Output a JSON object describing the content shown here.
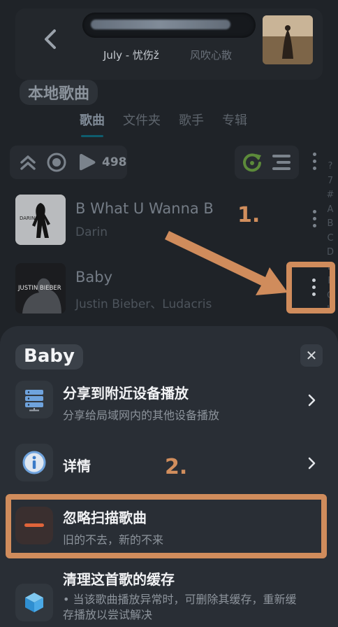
{
  "header": {
    "now_playing_title": "July - 忧伤ž",
    "now_playing_artist": "风吹心散"
  },
  "section_title": "本地歌曲",
  "tabs": [
    {
      "label": "歌曲",
      "active": true
    },
    {
      "label": "文件夹",
      "active": false
    },
    {
      "label": "歌手",
      "active": false
    },
    {
      "label": "专辑",
      "active": false
    }
  ],
  "toolbar": {
    "count": "498"
  },
  "alphabet_index": [
    "?",
    "7",
    "#",
    "A",
    "B",
    "C",
    "D",
    "E",
    "F",
    "G",
    "H"
  ],
  "songs": [
    {
      "title": "B What U Wanna B",
      "artist": "Darin",
      "cover_text": "DARIN"
    },
    {
      "title": "Baby",
      "artist": "Justin Bieber、Ludacris",
      "cover_text": "JUSTIN BIEBER"
    }
  ],
  "annotations": {
    "step1": "1.",
    "step2": "2."
  },
  "sheet": {
    "title": "Baby",
    "options": [
      {
        "label": "分享到附近设备播放",
        "sub": "分享给局域网内的其他设备播放",
        "icon": "server-icon"
      },
      {
        "label": "详情",
        "sub": "",
        "icon": "info-icon"
      },
      {
        "label": "忽略扫描歌曲",
        "sub": "旧的不去，新的不来",
        "icon": "minus-icon"
      },
      {
        "label": "清理这首歌的缓存",
        "sub": "• 当该歌曲播放异常时，可删除其缓存，重新缓存播放以尝试解决",
        "icon": "cube-icon"
      }
    ]
  },
  "colors": {
    "accent_orange": "#d08c5c",
    "sheet_bg": "#292e35",
    "page_bg": "#1f2328"
  }
}
